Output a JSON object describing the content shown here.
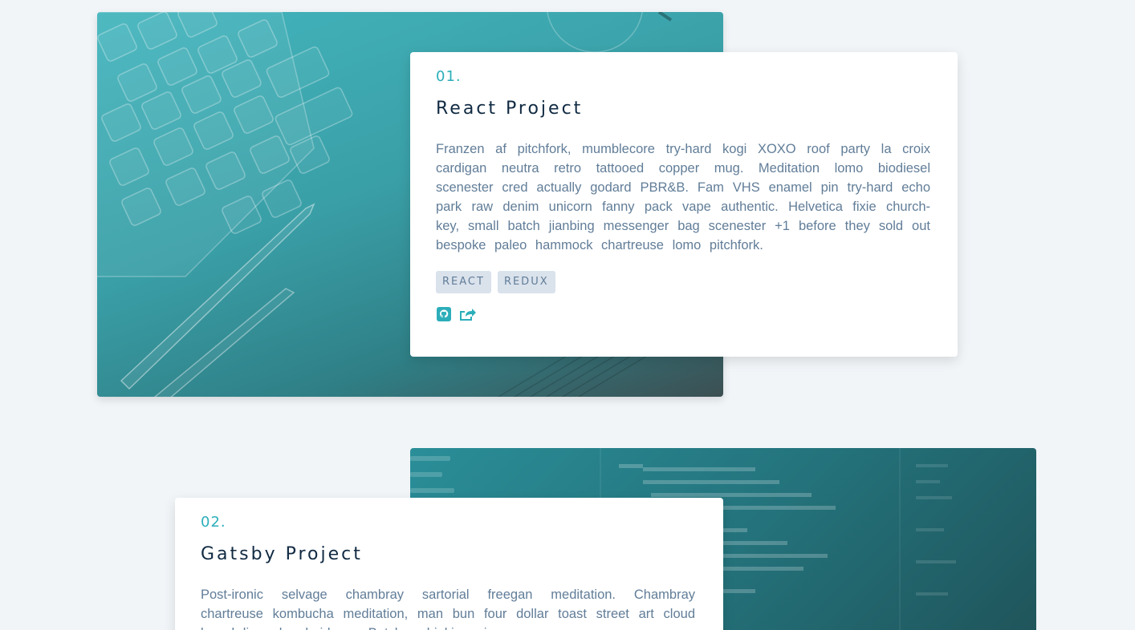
{
  "projects": [
    {
      "number": "01.",
      "title": "React Project",
      "description": "Franzen af pitchfork, mumblecore try-hard kogi XOXO roof party la croix cardigan neutra retro tattooed copper mug. Meditation lomo biodiesel scenester cred actually godard PBR&B. Fam VHS enamel pin try-hard echo park raw denim unicorn fanny pack vape authentic. Helvetica fixie church-key, small batch jianbing messenger bag scenester +1 before they sold out bespoke paleo hammock chartreuse lomo pitchfork.",
      "stack": [
        "REACT",
        "REDUX"
      ],
      "links": [
        "github-icon",
        "share-icon"
      ]
    },
    {
      "number": "02.",
      "title": "Gatsby Project",
      "description": "Post-ironic selvage chambray sartorial freegan meditation. Chambray chartreuse kombucha meditation, man bun four dollar toast street art cloud bread live-edge heirloom. Butcher drinking vinegar"
    }
  ],
  "colors": {
    "accent": "#2caeba",
    "background": "#f1f5f8",
    "heading": "#102a42",
    "text": "#617d98",
    "tag_bg": "#dae2ec"
  }
}
